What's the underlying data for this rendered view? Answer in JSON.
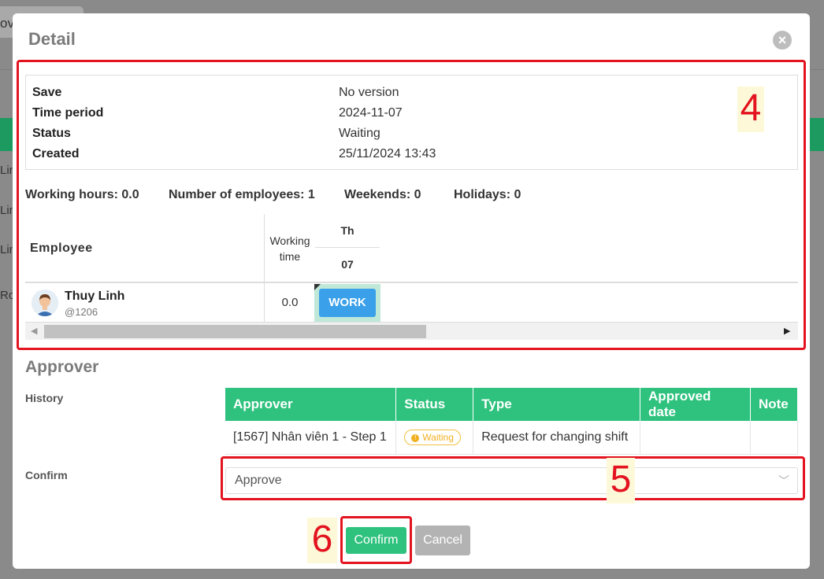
{
  "background": {
    "tab_fragment": "ov.",
    "row_fragments": [
      "Lin",
      "Lin",
      "Lin",
      "Ro"
    ]
  },
  "modal": {
    "title": "Detail",
    "close_icon": "close-icon"
  },
  "info": {
    "rows": [
      {
        "key": "Save",
        "value": "No version"
      },
      {
        "key": "Time period",
        "value": "2024-11-07"
      },
      {
        "key": "Status",
        "value": "Waiting"
      },
      {
        "key": "Created",
        "value": "25/11/2024 13:43"
      }
    ]
  },
  "stats": {
    "working_hours": "Working hours: 0.0",
    "employees": "Number of employees: 1",
    "weekends": "Weekends: 0",
    "holidays": "Holidays: 0"
  },
  "grid": {
    "employee_header": "Employee",
    "working_time_header": "Working time",
    "day_name": "Th",
    "day_number": "07",
    "employee": {
      "name": "Thuy Linh",
      "id": "@1206",
      "working_time": "0.0",
      "shift": "WORK"
    }
  },
  "approver": {
    "title": "Approver",
    "history_label": "History",
    "confirm_label": "Confirm",
    "columns": [
      "Approver",
      "Status",
      "Type",
      "Approved date",
      "Note"
    ],
    "rows": [
      {
        "approver": "[1567] Nhân viên 1 - Step 1",
        "status": "Waiting",
        "type": "Request for changing shift",
        "approved_date": "",
        "note": ""
      }
    ],
    "confirm_value": "Approve"
  },
  "buttons": {
    "confirm": "Confirm",
    "cancel": "Cancel"
  },
  "markers": {
    "m4": "4",
    "m5": "5",
    "m6": "6"
  },
  "colors": {
    "accent_green": "#2ec27e",
    "work_blue": "#3aa0ea",
    "highlight_red": "#e3131f"
  }
}
